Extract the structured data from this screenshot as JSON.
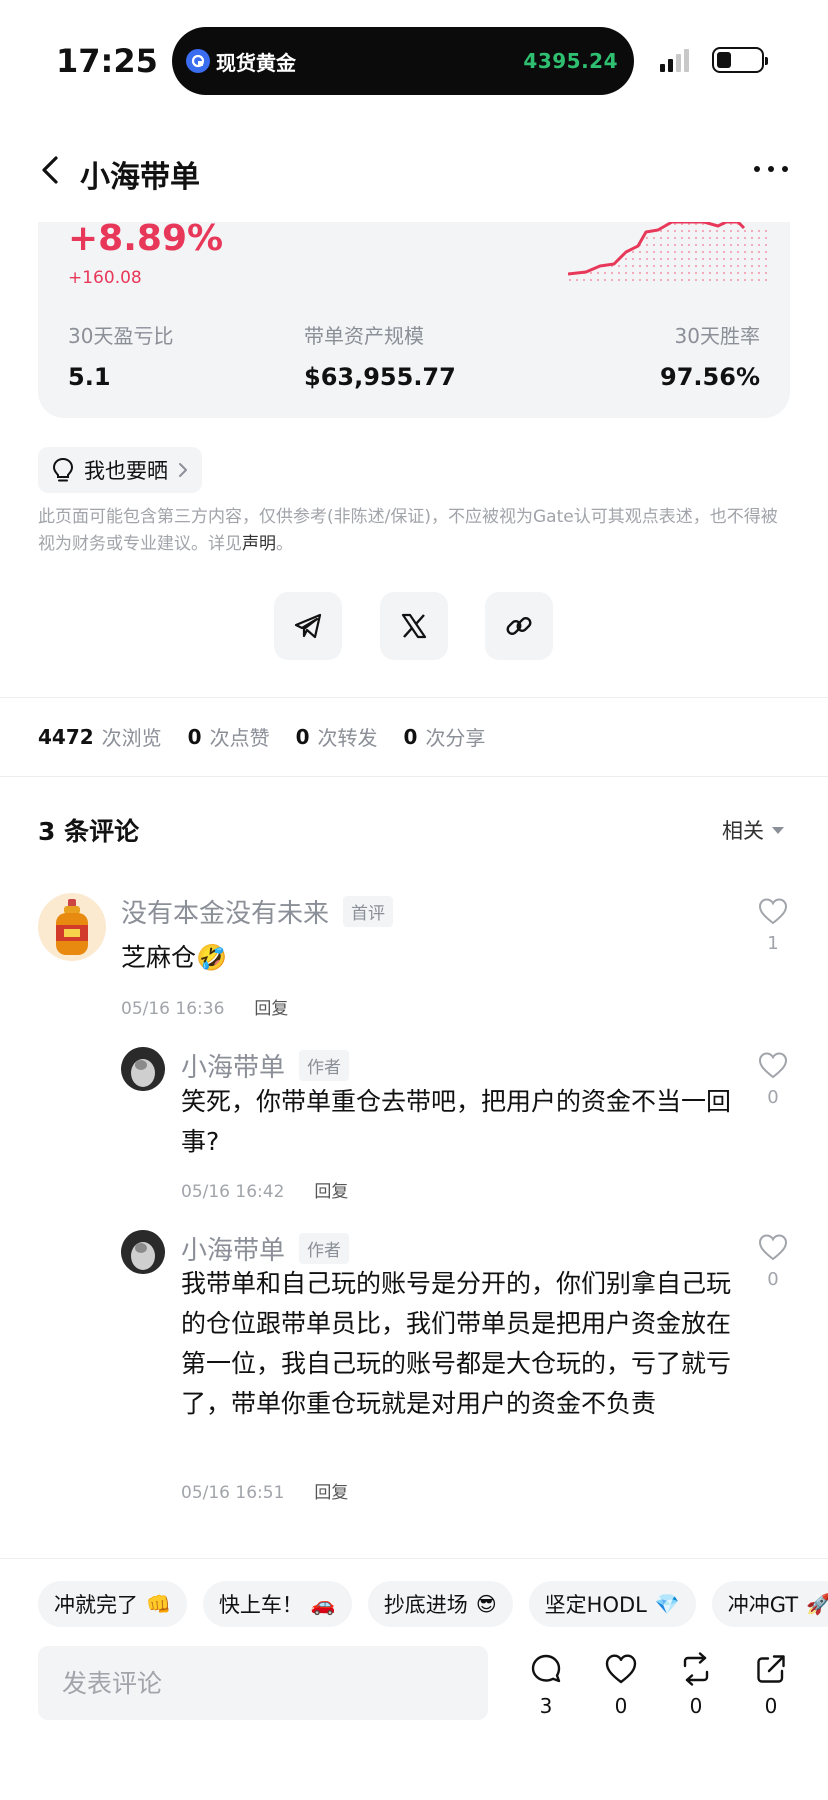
{
  "status_bar": {
    "time": "17:25",
    "island_title": "现货黄金",
    "island_price": "4395.24"
  },
  "header": {
    "title": "小海带单"
  },
  "stats": {
    "pnl_percent": "+8.89%",
    "pnl_amount": "+160.08",
    "metrics": [
      {
        "label": "30天盈亏比",
        "value": "5.1"
      },
      {
        "label": "带单资产规模",
        "value": "$63,955.77"
      },
      {
        "label": "30天胜率",
        "value": "97.56%"
      }
    ]
  },
  "share_tag": {
    "label": "我也要晒"
  },
  "disclaimer": {
    "text": "此页面可能包含第三方内容，仅供参考(非陈述/保证)，不应被视为Gate认可其观点表述，也不得被视为财务或专业建议。详见",
    "link": "声明",
    "end": "。"
  },
  "share_buttons": [
    "telegram-icon",
    "x-icon",
    "link-icon"
  ],
  "counts": [
    {
      "num": "4472",
      "unit": "次浏览"
    },
    {
      "num": "0",
      "unit": "次点赞"
    },
    {
      "num": "0",
      "unit": "次转发"
    },
    {
      "num": "0",
      "unit": "次分享"
    }
  ],
  "comments_section": {
    "title": "3 条评论",
    "sort": "相关"
  },
  "comments": [
    {
      "name": "没有本金没有未来",
      "badge": "首评",
      "body": "芝麻仓🤣",
      "time": "05/16 16:36",
      "reply": "回复",
      "likes": "1"
    },
    {
      "name": "小海带单",
      "badge": "作者",
      "body": "笑死，你带单重仓去带吧，把用户的资金不当一回事?",
      "time": "05/16 16:42",
      "reply": "回复",
      "likes": "0"
    },
    {
      "name": "小海带单",
      "badge": "作者",
      "body": "我带单和自己玩的账号是分开的，你们别拿自己玩的仓位跟带单员比，我们带单员是把用户资金放在第一位，我自己玩的账号都是大仓玩的，亏了就亏了，带单你重仓玩就是对用户的资金不负责",
      "time": "05/16 16:51",
      "reply": "回复",
      "likes": "0"
    }
  ],
  "quick_replies": [
    {
      "label": "冲就完了",
      "emoji": "👊"
    },
    {
      "label": "快上车！",
      "emoji": "🚗"
    },
    {
      "label": "抄底进场",
      "emoji": "😎"
    },
    {
      "label": "坚定HODL",
      "emoji": "💎"
    },
    {
      "label": "冲冲GT",
      "emoji": "🚀"
    }
  ],
  "bottom_bar": {
    "placeholder": "发表评论",
    "actions": [
      {
        "icon": "comment-icon",
        "count": "3"
      },
      {
        "icon": "heart-icon",
        "count": "0"
      },
      {
        "icon": "repost-icon",
        "count": "0"
      },
      {
        "icon": "share-icon",
        "count": "0"
      }
    ]
  },
  "colors": {
    "profit": "#e8385a",
    "island_price": "#2fbf71",
    "muted": "#8b8f97",
    "card_bg": "#f3f4f6"
  }
}
